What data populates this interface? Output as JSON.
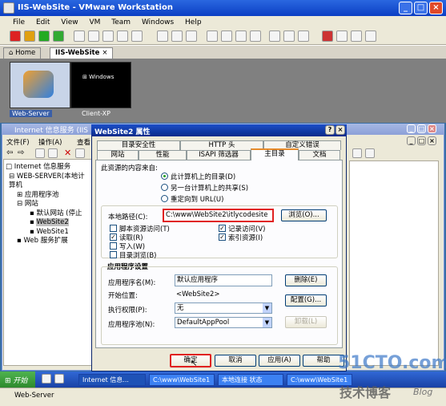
{
  "window": {
    "title": "IIS-WebSite - VMware Workstation"
  },
  "menu": [
    "File",
    "Edit",
    "View",
    "VM",
    "Team",
    "Windows",
    "Help"
  ],
  "tabs": {
    "home": "Home",
    "site": "IIS-WebSite"
  },
  "vms": [
    {
      "label": "Web-Server"
    },
    {
      "label": "Client-XP"
    }
  ],
  "iis": {
    "title": "Internet 信息服务 (IIS",
    "menu": [
      "文件(F)",
      "操作(A)",
      "查看"
    ],
    "tree": [
      "Internet 信息服务",
      "WEB-SERVER(本地计算机",
      "应用程序池",
      "网站",
      "默认网站 (停止",
      "WebSite2",
      "WebSite1",
      "Web 服务扩展"
    ]
  },
  "dialog": {
    "title": "WebSite2 属性",
    "tabs_row1": [
      "目录安全性",
      "HTTP 头",
      "自定义错误"
    ],
    "tabs_row2": [
      "网站",
      "性能",
      "ISAPI 筛选器",
      "主目录",
      "文档"
    ],
    "source_label": "此资源的内容来自:",
    "radios": [
      "此计算机上的目录(D)",
      "另一台计算机上的共享(S)",
      "重定向到 URL(U)"
    ],
    "local_path_label": "本地路径(C):",
    "local_path_value": "C:\\www\\WebSite2\\itlycodesite",
    "browse": "浏览(O)...",
    "checks_left": [
      {
        "label": "脚本资源访问(T)",
        "checked": false
      },
      {
        "label": "读取(R)",
        "checked": true
      },
      {
        "label": "写入(W)",
        "checked": false
      },
      {
        "label": "目录浏览(B)",
        "checked": false
      }
    ],
    "checks_right": [
      {
        "label": "记录访问(V)",
        "checked": true
      },
      {
        "label": "索引资源(I)",
        "checked": true
      }
    ],
    "app_settings": "应用程序设置",
    "app_name_label": "应用程序名(M):",
    "app_name_value": "默认应用程序",
    "remove": "删除(E)",
    "start_label": "开始位置:",
    "start_value": "<WebSite2>",
    "config": "配置(G)...",
    "exec_label": "执行权限(P):",
    "exec_value": "无",
    "pool_label": "应用程序池(N):",
    "pool_value": "DefaultAppPool",
    "unload": "卸载(L)",
    "ok": "确定",
    "cancel": "取消",
    "apply": "应用(A)",
    "help": "帮助"
  },
  "taskbar": {
    "start": "开始",
    "items": [
      "Internet 信息...",
      "C:\\www\\WebSite1",
      "本地连接 状态",
      "C:\\www\\WebSite1"
    ]
  },
  "status": {
    "vm": "Web-Server"
  },
  "watermark": {
    "site": "51CTO.com",
    "sub": "技术博客",
    "blog": "Blog"
  }
}
